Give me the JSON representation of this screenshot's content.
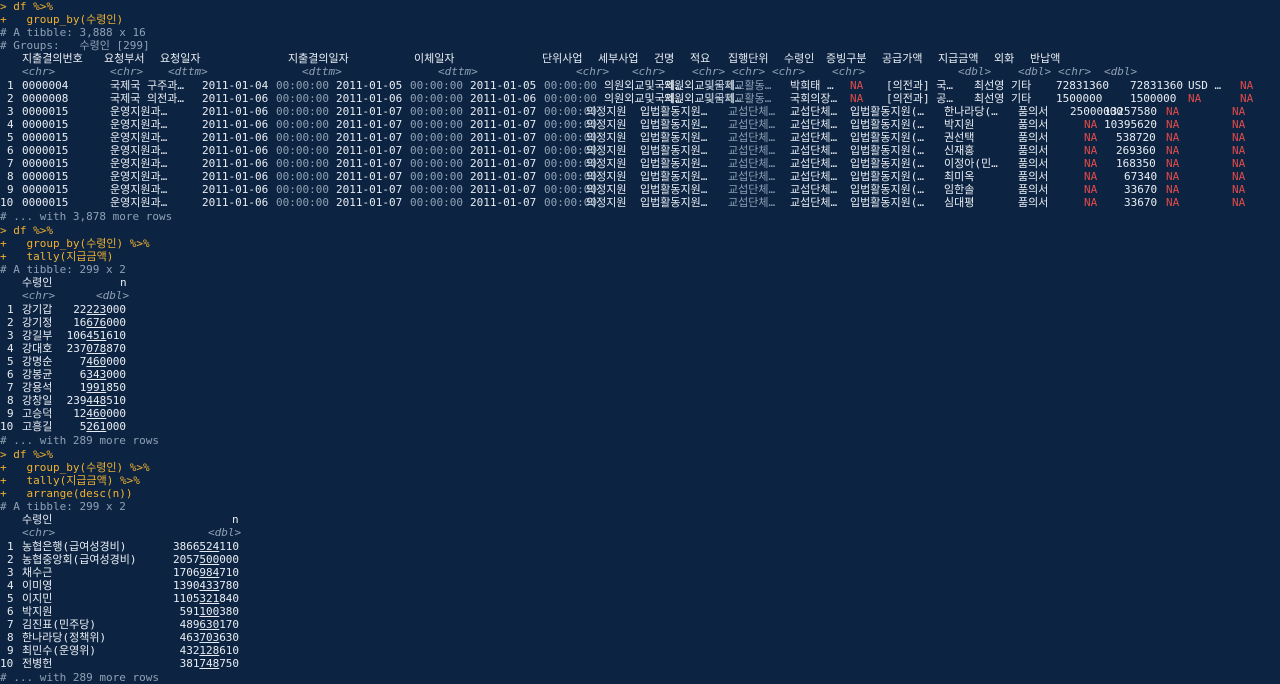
{
  "colors": {
    "background": "#0c2442",
    "prompt": "#f0b030",
    "na": "#e24a4a",
    "comment": "#8fa0b4",
    "text": "#e8ecf2"
  },
  "block1": {
    "cmd1": "> df %>%",
    "cmd2": "+   group_by(수령인)",
    "tibble": "# A tibble: 3,888 x 16",
    "groups": "# Groups:   수령인 [299]",
    "headers": [
      "지출결의번호",
      "요청부서",
      "요청일자",
      "지출결의일자",
      "이체일자",
      "단위사업",
      "세부사업",
      "건명",
      "적요",
      "집행단위",
      "수령인",
      "증빙구분",
      "공급가액",
      "지급금액",
      "외화",
      "반납액"
    ],
    "types": [
      "<chr>",
      "<chr>",
      "<dttm>",
      "<dttm>",
      "<dttm>",
      "<chr>",
      "<chr>",
      "<chr>",
      "<chr>",
      "<chr>",
      "<chr>",
      "<dbl>",
      "<dbl>",
      "<chr>",
      "<dbl>"
    ],
    "rows": [
      {
        "n": "1",
        "id": "0000004",
        "dept": "국제국 구주과…",
        "d1": "2011-01-04",
        "t1": "00:00:00",
        "d2": "2011-01-05",
        "t2": "00:00:00",
        "d3": "2011-01-05",
        "t3": "00:00:00",
        "biz": "의원외교및국제…",
        "sub": "의원외교및국제…",
        "title": "의원외교활동…",
        "memo": "박희태 …",
        "unit": "NA",
        "recv": "[의전과] 국…",
        "proof": "최선영 기타",
        "supply": "72831360",
        "pay": "72831360",
        "fx": "USD …",
        "ret": "NA"
      },
      {
        "n": "2",
        "id": "0000008",
        "dept": "국제국 의전과…",
        "d1": "2011-01-06",
        "t1": "00:00:00",
        "d2": "2011-01-06",
        "t2": "00:00:00",
        "d3": "2011-01-06",
        "t3": "00:00:00",
        "biz": "의원외교및국제…",
        "sub": "의원외교및국제…",
        "title": "의원외교활동…",
        "memo": "국회의장…",
        "unit": "NA",
        "recv": "[의전과] 공…",
        "proof": "최선영 기타",
        "supply": "1500000",
        "pay": "1500000",
        "fx": "NA",
        "ret": "NA"
      },
      {
        "n": "3",
        "id": "0000015",
        "dept": "운영지원과…",
        "d1": "2011-01-06",
        "t1": "00:00:00",
        "d2": "2011-01-07",
        "t2": "00:00:00",
        "d3": "2011-01-07",
        "t3": "00:00:00",
        "biz": "의정지원",
        "sub": "입법활동지원…",
        "title": "교섭단체…",
        "memo": "교섭단체…",
        "unit": "입법활동지원(…",
        "recv": "한나라당(…",
        "proof": "품의서",
        "supply": "25000000",
        "pay": "13257580",
        "fx": "NA",
        "ret": "NA"
      },
      {
        "n": "4",
        "id": "0000015",
        "dept": "운영지원과…",
        "d1": "2011-01-06",
        "t1": "00:00:00",
        "d2": "2011-01-07",
        "t2": "00:00:00",
        "d3": "2011-01-07",
        "t3": "00:00:00",
        "biz": "의정지원",
        "sub": "입법활동지원…",
        "title": "교섭단체…",
        "memo": "교섭단체…",
        "unit": "입법활동지원(…",
        "recv": "박지원",
        "proof": "품의서",
        "supply": "NA",
        "pay": "10395620",
        "fx": "NA",
        "ret": "NA"
      },
      {
        "n": "5",
        "id": "0000015",
        "dept": "운영지원과…",
        "d1": "2011-01-06",
        "t1": "00:00:00",
        "d2": "2011-01-07",
        "t2": "00:00:00",
        "d3": "2011-01-07",
        "t3": "00:00:00",
        "biz": "의정지원",
        "sub": "입법활동지원…",
        "title": "교섭단체…",
        "memo": "교섭단체…",
        "unit": "입법활동지원(…",
        "recv": "권선택",
        "proof": "품의서",
        "supply": "NA",
        "pay": "538720",
        "fx": "NA",
        "ret": "NA"
      },
      {
        "n": "6",
        "id": "0000015",
        "dept": "운영지원과…",
        "d1": "2011-01-06",
        "t1": "00:00:00",
        "d2": "2011-01-07",
        "t2": "00:00:00",
        "d3": "2011-01-07",
        "t3": "00:00:00",
        "biz": "의정지원",
        "sub": "입법활동지원…",
        "title": "교섭단체…",
        "memo": "교섭단체…",
        "unit": "입법활동지원(…",
        "recv": "신재홍",
        "proof": "품의서",
        "supply": "NA",
        "pay": "269360",
        "fx": "NA",
        "ret": "NA"
      },
      {
        "n": "7",
        "id": "0000015",
        "dept": "운영지원과…",
        "d1": "2011-01-06",
        "t1": "00:00:00",
        "d2": "2011-01-07",
        "t2": "00:00:00",
        "d3": "2011-01-07",
        "t3": "00:00:00",
        "biz": "의정지원",
        "sub": "입법활동지원…",
        "title": "교섭단체…",
        "memo": "교섭단체…",
        "unit": "입법활동지원(…",
        "recv": "이정아(민…",
        "proof": "품의서",
        "supply": "NA",
        "pay": "168350",
        "fx": "NA",
        "ret": "NA"
      },
      {
        "n": "8",
        "id": "0000015",
        "dept": "운영지원과…",
        "d1": "2011-01-06",
        "t1": "00:00:00",
        "d2": "2011-01-07",
        "t2": "00:00:00",
        "d3": "2011-01-07",
        "t3": "00:00:00",
        "biz": "의정지원",
        "sub": "입법활동지원…",
        "title": "교섭단체…",
        "memo": "교섭단체…",
        "unit": "입법활동지원(…",
        "recv": "최미옥",
        "proof": "품의서",
        "supply": "NA",
        "pay": "67340",
        "fx": "NA",
        "ret": "NA"
      },
      {
        "n": "9",
        "id": "0000015",
        "dept": "운영지원과…",
        "d1": "2011-01-06",
        "t1": "00:00:00",
        "d2": "2011-01-07",
        "t2": "00:00:00",
        "d3": "2011-01-07",
        "t3": "00:00:00",
        "biz": "의정지원",
        "sub": "입법활동지원…",
        "title": "교섭단체…",
        "memo": "교섭단체…",
        "unit": "입법활동지원(…",
        "recv": "임한솔",
        "proof": "품의서",
        "supply": "NA",
        "pay": "33670",
        "fx": "NA",
        "ret": "NA"
      },
      {
        "n": "10",
        "id": "0000015",
        "dept": "운영지원과…",
        "d1": "2011-01-06",
        "t1": "00:00:00",
        "d2": "2011-01-07",
        "t2": "00:00:00",
        "d3": "2011-01-07",
        "t3": "00:00:00",
        "biz": "의정지원",
        "sub": "입법활동지원…",
        "title": "교섭단체…",
        "memo": "교섭단체…",
        "unit": "입법활동지원(…",
        "recv": "심대평",
        "proof": "품의서",
        "supply": "NA",
        "pay": "33670",
        "fx": "NA",
        "ret": "NA"
      }
    ],
    "more": "# ... with 3,878 more rows"
  },
  "block2": {
    "cmd1": "> df %>%",
    "cmd2": "+   group_by(수령인) %>%",
    "cmd3": "+   tally(지급금액)",
    "tibble": "# A tibble: 299 x 2",
    "h1": "수령인",
    "h2": "n",
    "ty1": "<chr>",
    "ty2": "<dbl>",
    "rows": [
      {
        "n": "1",
        "name": "강기갑",
        "a": "22",
        "b": "223",
        "c": "000"
      },
      {
        "n": "2",
        "name": "강기정",
        "a": "16",
        "b": "676",
        "c": "000"
      },
      {
        "n": "3",
        "name": "강길부",
        "a": "106",
        "b": "451",
        "c": "610"
      },
      {
        "n": "4",
        "name": "강대호",
        "a": "237",
        "b": "078",
        "c": "870"
      },
      {
        "n": "5",
        "name": "강명순",
        "a": "7",
        "b": "460",
        "c": "000"
      },
      {
        "n": "6",
        "name": "강봉균",
        "a": "6",
        "b": "343",
        "c": "000"
      },
      {
        "n": "7",
        "name": "강용석",
        "a": "1",
        "b": "991",
        "c": "850"
      },
      {
        "n": "8",
        "name": "강창일",
        "a": "239",
        "b": "448",
        "c": "510"
      },
      {
        "n": "9",
        "name": "고승덕",
        "a": "12",
        "b": "460",
        "c": "000"
      },
      {
        "n": "10",
        "name": "고흥길",
        "a": "5",
        "b": "261",
        "c": "000"
      }
    ],
    "more": "# ... with 289 more rows"
  },
  "block3": {
    "cmd1": "> df %>%",
    "cmd2": "+   group_by(수령인) %>%",
    "cmd3": "+   tally(지급금액) %>%",
    "cmd4": "+   arrange(desc(n))",
    "tibble": "# A tibble: 299 x 2",
    "h1": "수령인",
    "h2": "n",
    "ty1": "<chr>",
    "ty2": "<dbl>",
    "rows": [
      {
        "n": "1",
        "name": "농협은행(급여성경비)",
        "a": "3866",
        "b": "524",
        "c": "110"
      },
      {
        "n": "2",
        "name": "농협중앙회(급여성경비)",
        "a": "2057",
        "b": "500",
        "c": "000"
      },
      {
        "n": "3",
        "name": "채수근",
        "a": "1706",
        "b": "984",
        "c": "710"
      },
      {
        "n": "4",
        "name": "이미영",
        "a": "1390",
        "b": "433",
        "c": "780"
      },
      {
        "n": "5",
        "name": "이지민",
        "a": "1105",
        "b": "321",
        "c": "840"
      },
      {
        "n": "6",
        "name": "박지원",
        "a": "591",
        "b": "100",
        "c": "380"
      },
      {
        "n": "7",
        "name": "김진표(민주당)",
        "a": "489",
        "b": "630",
        "c": "170"
      },
      {
        "n": "8",
        "name": "한나라당(정책위)",
        "a": "463",
        "b": "703",
        "c": "630"
      },
      {
        "n": "9",
        "name": "최민수(운영위)",
        "a": "432",
        "b": "128",
        "c": "610"
      },
      {
        "n": "10",
        "name": "전병헌",
        "a": "381",
        "b": "748",
        "c": "750"
      }
    ],
    "more": "# ... with 289 more rows"
  }
}
